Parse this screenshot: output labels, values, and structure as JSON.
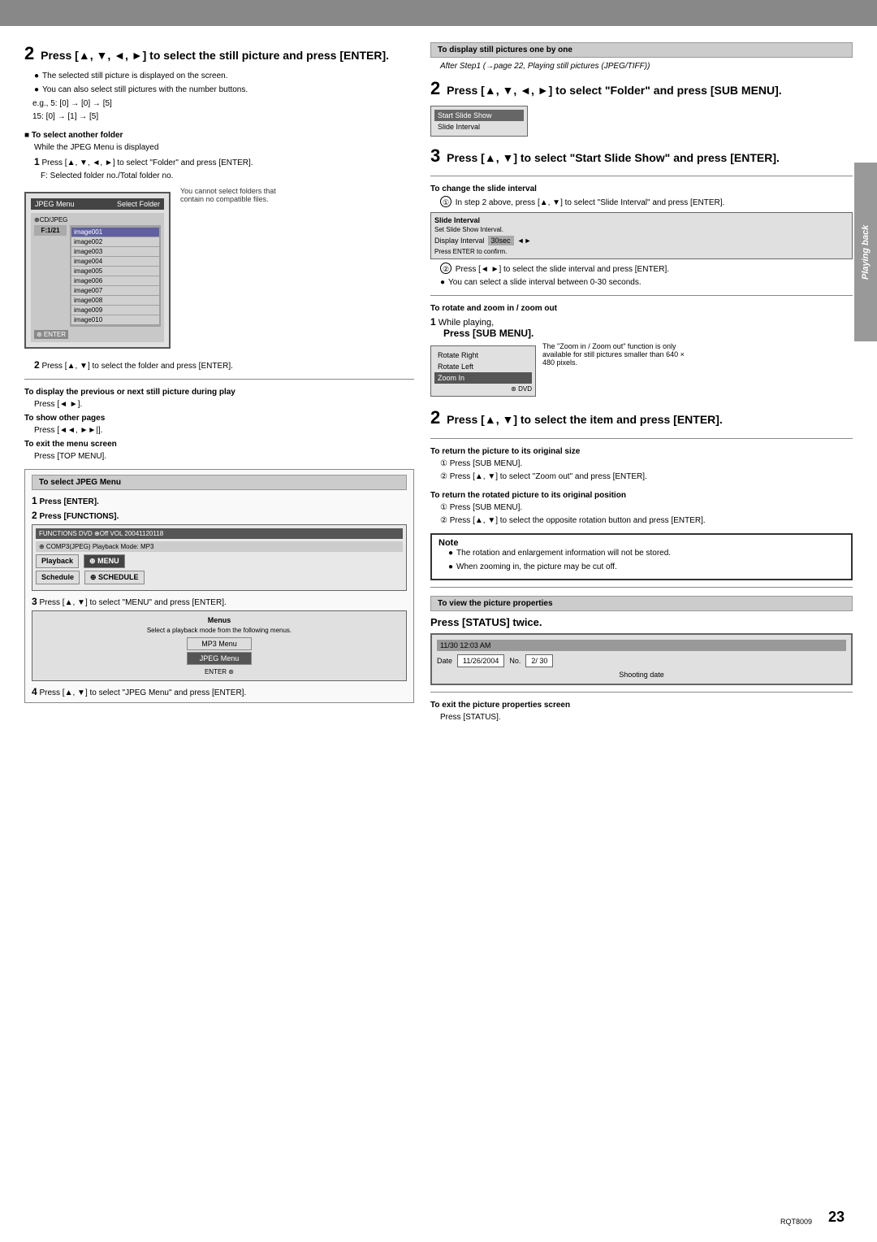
{
  "page": {
    "header_bg": "#888",
    "page_number": "23",
    "model_number": "RQT8009",
    "tab_label": "Playing back"
  },
  "left_column": {
    "main_step": {
      "number": "2",
      "title": "Press [▲, ▼, ◄, ►] to select the still picture and press [ENTER].",
      "bullets": [
        "The selected still picture is displayed on the screen.",
        "You can also select still pictures with the number buttons."
      ],
      "example_text": "e.g., 5:  [0] → [0] → [5]",
      "example_text2": "15: [0] → [1] → [5]"
    },
    "select_folder": {
      "title": "■ To select another folder",
      "subtitle": "While the JPEG Menu is displayed",
      "step1": "Press [▲, ▼, ◄, ►] to select \"Folder\" and press [ENTER].",
      "folder_note": "F: Selected folder no./Total folder no.",
      "screen_title_left": "JPEG Menu",
      "screen_title_right": "Select Folder",
      "screen_subtitle": "⊕CD/JPEG",
      "folder_badge": "F:1/21",
      "folder_items": [
        "image001",
        "image002",
        "image003",
        "image004",
        "image005",
        "image006",
        "image007",
        "image008",
        "image009",
        "image010"
      ],
      "selected_item": "image001",
      "side_note": "You cannot\nselect folders\nthat contain no\ncompatible files.",
      "step2": "Press [▲, ▼] to select the folder and press [ENTER]."
    },
    "during_play": {
      "title": "To display the previous or next still picture during play",
      "text": "Press [◄ ►].",
      "show_pages_title": "To show other pages",
      "show_pages_text": "Press [◄◄, ►►|].",
      "exit_title": "To exit the menu screen",
      "exit_text": "Press [TOP MENU]."
    },
    "jpeg_menu": {
      "header": "To select JPEG Menu",
      "step1_label": "Press [ENTER].",
      "step2_label": "Press [FUNCTIONS].",
      "screen_top": "FUNCTIONS  DVD    ⊕Off  VOL 20041120118",
      "screen_sub": "⊕ COMP3(JPEG)      Playback Mode: MP3",
      "btn_playback": "Playback",
      "btn_menu": "⊕ MENU",
      "btn_schedule": "Schedule",
      "btn_schedule2": "⊕ SCHEDULE"
    },
    "step3_jpeg": {
      "label": "Press [▲, ▼] to select \"MENU\" and press [ENTER].",
      "menu_title": "Menus",
      "menu_desc": "Select a playback mode from\nthe following menus.",
      "btn_mp3": "MP3 Menu",
      "btn_jpeg": "JPEG Menu"
    },
    "step4_jpeg": {
      "label": "Press [▲, ▼] to select \"JPEG Menu\" and press [ENTER]."
    }
  },
  "right_column": {
    "display_still": {
      "header": "To display still pictures one by one",
      "after_step": "After Step1 (→page 22, Playing still pictures (JPEG/TIFF))"
    },
    "step2_right": {
      "number": "2",
      "title": "Press [▲, ▼, ◄, ►] to select \"Folder\" and press [SUB MENU].",
      "menu_items": [
        "Start Slide Show",
        "Slide Interval"
      ]
    },
    "step3_right": {
      "number": "3",
      "title": "Press [▲, ▼] to select \"Start Slide Show\" and press [ENTER]."
    },
    "slide_interval": {
      "title": "To change the slide interval",
      "step1": "In step 2 above, press [▲, ▼] to select \"Slide Interval\" and press [ENTER].",
      "screen_title": "Slide Interval",
      "screen_sub": "Set Slide Show Interval.",
      "label_display": "Display Interval",
      "value": "30sec",
      "press_enter": "Press ENTER to confirm.",
      "step2": "Press [◄ ►] to select the slide interval and press [ENTER].",
      "bullet": "You can select a slide interval between 0-30 seconds."
    },
    "rotate_zoom": {
      "title": "To rotate and zoom in / zoom out",
      "step1_label": "While playing,",
      "step1_action": "Press [SUB MENU].",
      "screen_items": [
        "Rotate Right",
        "Rotate Left",
        "Zoom In"
      ],
      "screen_selected": "Zoom In",
      "zoom_note": "The \"Zoom in / Zoom out\" function is\nonly available for still pictures smaller\nthan 640 × 480 pixels."
    },
    "step2_rotate": {
      "number": "2",
      "title": "Press [▲, ▼] to select the item and press [ENTER]."
    },
    "return_original": {
      "title": "To return the picture to its original size",
      "step1": "① Press [SUB MENU].",
      "step2": "② Press [▲, ▼] to select \"Zoom out\" and press [ENTER]."
    },
    "return_position": {
      "title": "To return the rotated picture to its original position",
      "step1": "① Press [SUB MENU].",
      "step2": "② Press [▲, ▼] to select the opposite rotation button and press [ENTER]."
    },
    "note": {
      "label": "Note",
      "bullets": [
        "The rotation and enlargement information will not be stored.",
        "When zooming in, the picture may be cut off."
      ]
    },
    "picture_properties": {
      "header": "To view the picture properties",
      "action": "Press [STATUS] twice.",
      "screen_date_time": "11/30  12:03 AM",
      "screen_date_label": "Date",
      "screen_date_value": "11/26/2004",
      "screen_no_label": "No.",
      "screen_no_value": "2/ 30",
      "shooting_date_label": "Shooting date"
    },
    "exit_properties": {
      "title": "To exit the picture properties screen",
      "text": "Press [STATUS]."
    }
  }
}
